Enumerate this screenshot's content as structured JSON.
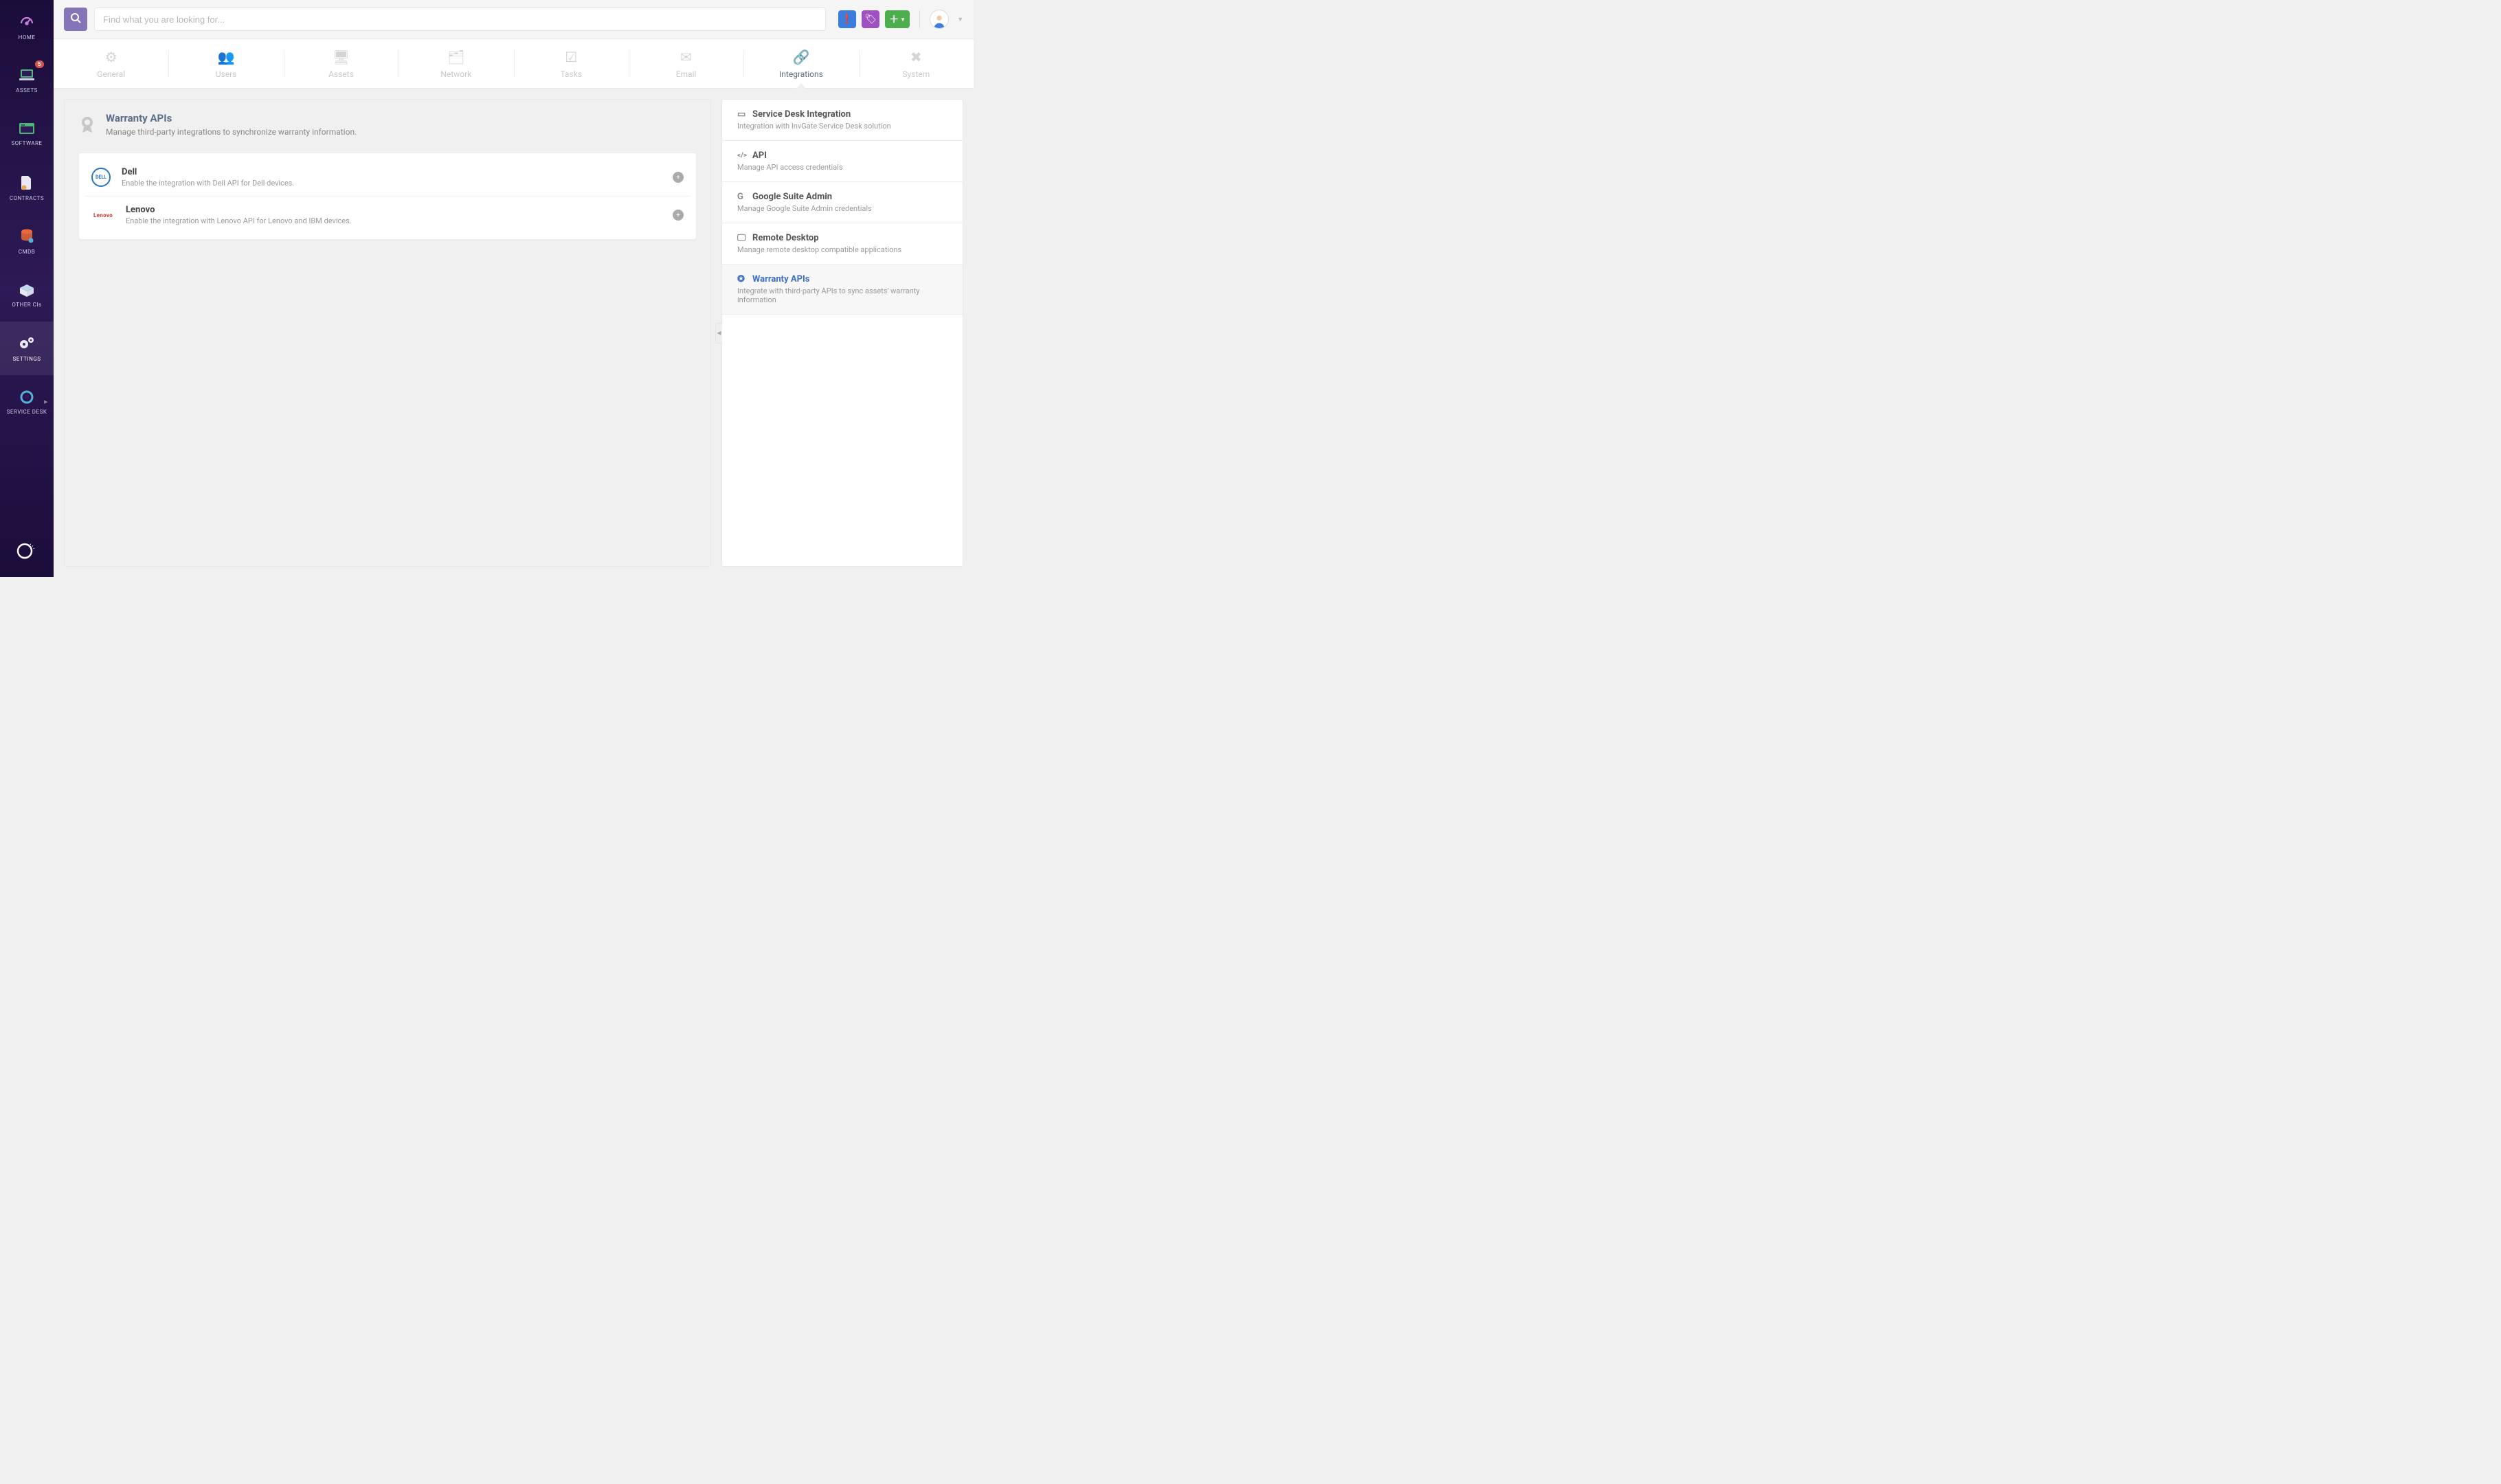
{
  "sidebar": {
    "items": [
      {
        "label": "HOME",
        "icon": "gauge"
      },
      {
        "label": "ASSETS",
        "icon": "laptop",
        "badge": "5"
      },
      {
        "label": "SOFTWARE",
        "icon": "window"
      },
      {
        "label": "CONTRACTS",
        "icon": "doc"
      },
      {
        "label": "CMDB",
        "icon": "db"
      },
      {
        "label": "OTHER CIs",
        "icon": "box"
      },
      {
        "label": "SETTINGS",
        "icon": "gears",
        "active": true
      },
      {
        "label": "SERVICE DESK",
        "icon": "ring"
      }
    ]
  },
  "topbar": {
    "search_placeholder": "Find what you are looking for..."
  },
  "tabs": [
    {
      "label": "General",
      "icon": "⚙"
    },
    {
      "label": "Users",
      "icon": "👥"
    },
    {
      "label": "Assets",
      "icon": "🖥"
    },
    {
      "label": "Network",
      "icon": "🗂"
    },
    {
      "label": "Tasks",
      "icon": "☑"
    },
    {
      "label": "Email",
      "icon": "✉"
    },
    {
      "label": "Integrations",
      "icon": "🔗",
      "active": true
    },
    {
      "label": "System",
      "icon": "✖"
    }
  ],
  "panel": {
    "title": "Warranty APIs",
    "subtitle": "Manage third-party integrations to synchronize warranty information.",
    "cards": [
      {
        "logo": "dell",
        "title": "Dell",
        "desc": "Enable the integration with Dell API for Dell devices."
      },
      {
        "logo": "lenovo",
        "logo_text": "Lenovo",
        "title": "Lenovo",
        "desc": "Enable the integration with Lenovo API for Lenovo and IBM devices."
      }
    ]
  },
  "right": [
    {
      "icon": "▭",
      "title": "Service Desk Integration",
      "desc": "Integration with InvGate Service Desk solution"
    },
    {
      "icon": "</>",
      "title": "API",
      "desc": "Manage API access credentials"
    },
    {
      "icon": "G",
      "title": "Google Suite Admin",
      "desc": "Manage Google Suite Admin credentials"
    },
    {
      "icon": "🖵",
      "title": "Remote Desktop",
      "desc": "Manage remote desktop compatible applications"
    },
    {
      "icon": "✪",
      "title": "Warranty APIs",
      "desc": "Integrate with third-party APIs to sync assets' warranty information",
      "active": true
    }
  ]
}
